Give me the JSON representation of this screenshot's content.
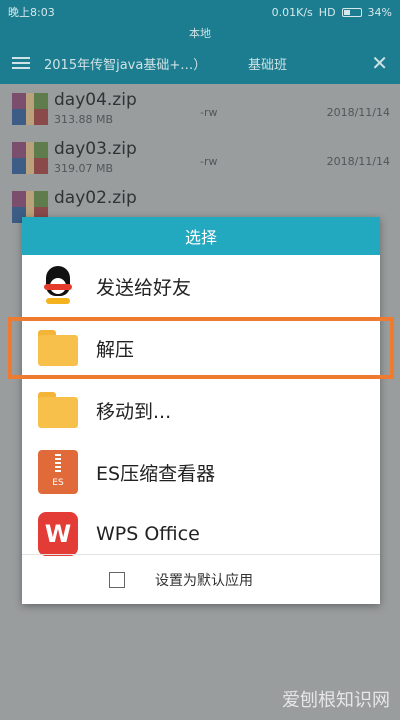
{
  "statusbar": {
    "time": "晚上8:03",
    "speed": "0.01K/s",
    "network": "HD",
    "battery": "34%"
  },
  "subbar": {
    "label": "本地"
  },
  "toolbar": {
    "path": "2015年传智java基础+…）",
    "tab": "基础班"
  },
  "files": [
    {
      "name": "day04.zip",
      "size": "313.88 MB",
      "perm": "-rw",
      "date": "2018/11/14"
    },
    {
      "name": "day03.zip",
      "size": "319.07 MB",
      "perm": "-rw",
      "date": "2018/11/14"
    },
    {
      "name": "day02.zip",
      "size": "",
      "perm": "",
      "date": ""
    }
  ],
  "dialog": {
    "title": "选择",
    "options": [
      {
        "label": "发送给好友",
        "icon": "qq-icon"
      },
      {
        "label": "解压",
        "icon": "folder-icon"
      },
      {
        "label": "移动到...",
        "icon": "folder-icon"
      },
      {
        "label": "ES压缩查看器",
        "icon": "es-zip-icon"
      },
      {
        "label": "WPS Office",
        "icon": "wps-icon"
      }
    ],
    "es_icon_text": "ES",
    "wps_icon_text": "W",
    "footer_label": "设置为默认应用"
  },
  "watermark": "爱刨根知识网",
  "colors": {
    "dialog_header": "#22a8bf",
    "highlight": "#ee7b2f",
    "toolbar": "#1b7d8f"
  }
}
